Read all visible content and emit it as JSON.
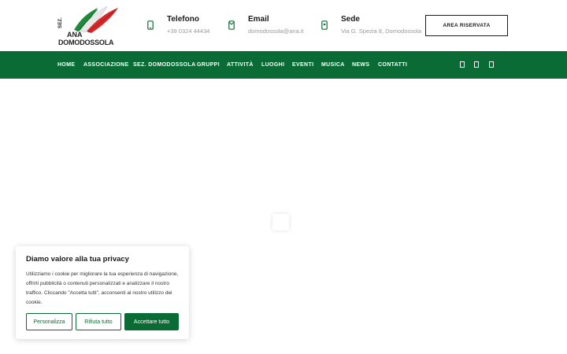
{
  "logo": {
    "line1": "SEZ.",
    "line2": "ANA",
    "line3": "DOMODOSSOLA",
    "colors": {
      "green": "#1f8a3c",
      "red": "#d62828",
      "dark": "#222222"
    }
  },
  "contacts": [
    {
      "title": "Telefono",
      "value": "+39 0324 44434",
      "icon": "phone-icon"
    },
    {
      "title": "Email",
      "value": "domodossola@ana.it",
      "icon": "envelope-icon"
    },
    {
      "title": "Sede",
      "value": "Via G. Spezia 8, Domodossola",
      "icon": "map-pin-icon"
    }
  ],
  "area_button": "AREA RISERVATA",
  "nav": {
    "items": [
      "HOME",
      "ASSOCIAZIONE",
      "SEZ. DOMODOSSOLA",
      "GRUPPI",
      "ATTIVITÀ",
      "LUOGHI",
      "EVENTI",
      "MUSICA",
      "NEWS",
      "CONTATTI"
    ],
    "social": [
      "facebook-icon",
      "instagram-icon",
      "youtube-icon"
    ],
    "color": "#0b6b35"
  },
  "cookie": {
    "title": "Diamo valore alla tua privacy",
    "text": "Utilizziamo i cookie per migliorare la tua esperienza di navigazione, offrirti pubblicità o contenuti personalizzati e analizzare il nostro traffico. Cliccando \"Accetta tutti\", acconsenti al nostro utilizzo dei cookie.",
    "btn_customize": "Personalizza",
    "btn_reject": "Rifiuta tutto",
    "btn_accept": "Accettare tutto"
  }
}
